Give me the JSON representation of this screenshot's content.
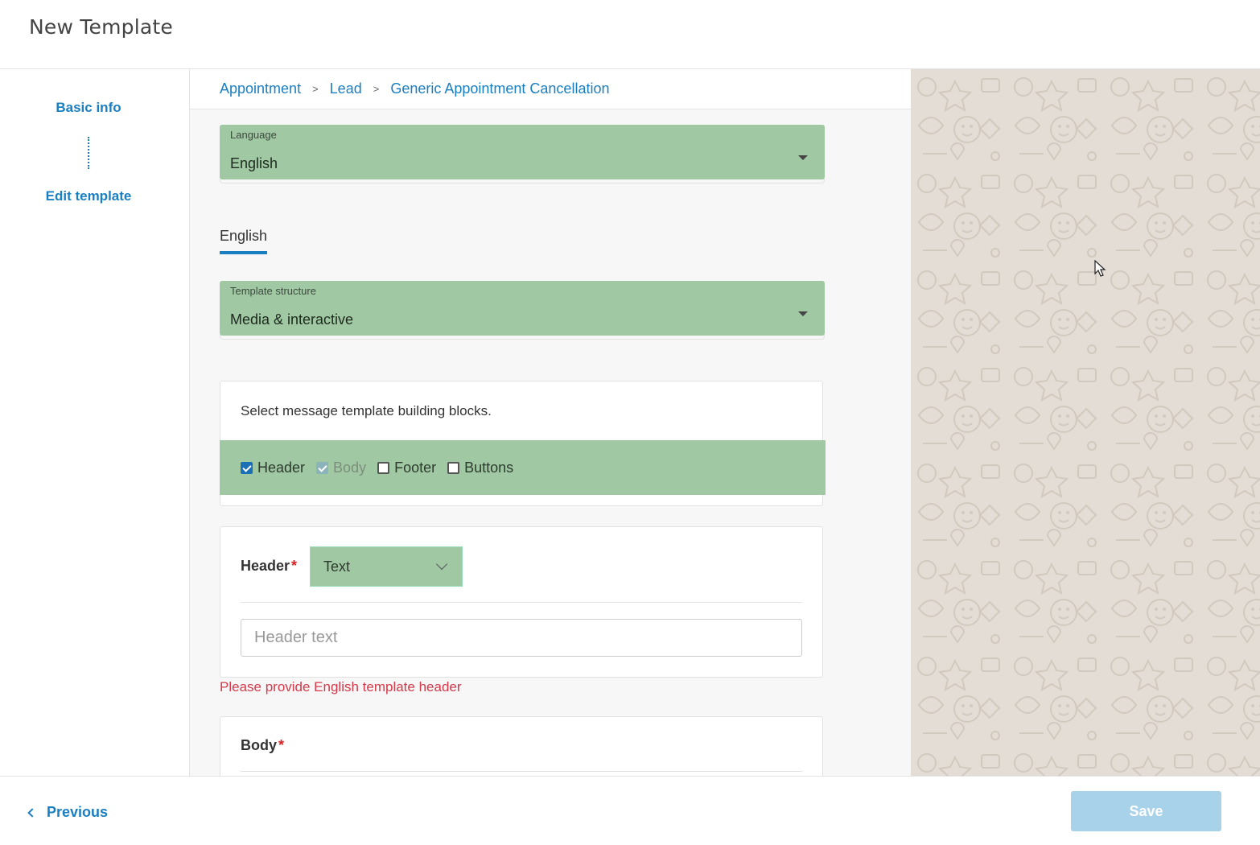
{
  "header": {
    "title": "New Template"
  },
  "sidebar": {
    "steps": [
      {
        "label": "Basic info"
      },
      {
        "label": "Edit template"
      }
    ]
  },
  "breadcrumb": {
    "items": [
      "Appointment",
      "Lead",
      "Generic Appointment Cancellation"
    ],
    "separator": ">"
  },
  "language": {
    "label": "Language",
    "value": "English"
  },
  "tab": {
    "label": "English"
  },
  "structure": {
    "label": "Template structure",
    "value": "Media & interactive"
  },
  "blocks": {
    "intro": "Select message template building blocks.",
    "options": [
      {
        "label": "Header",
        "checked": true,
        "disabled": false
      },
      {
        "label": "Body",
        "checked": true,
        "disabled": true
      },
      {
        "label": "Footer",
        "checked": false,
        "disabled": false
      },
      {
        "label": "Buttons",
        "checked": false,
        "disabled": false
      }
    ]
  },
  "header_section": {
    "label": "Header",
    "required_mark": "*",
    "type_value": "Text",
    "input_placeholder": "Header text",
    "error": "Please provide English template header"
  },
  "body_section": {
    "label": "Body",
    "required_mark": "*"
  },
  "footer": {
    "previous_label": "Previous",
    "save_label": "Save"
  },
  "colors": {
    "accent": "#1a7fc1",
    "highlight": "#a0c8a3",
    "error": "#d33a4a",
    "save_disabled": "#a8d2ea",
    "preview_bg": "#e4ddd5"
  }
}
